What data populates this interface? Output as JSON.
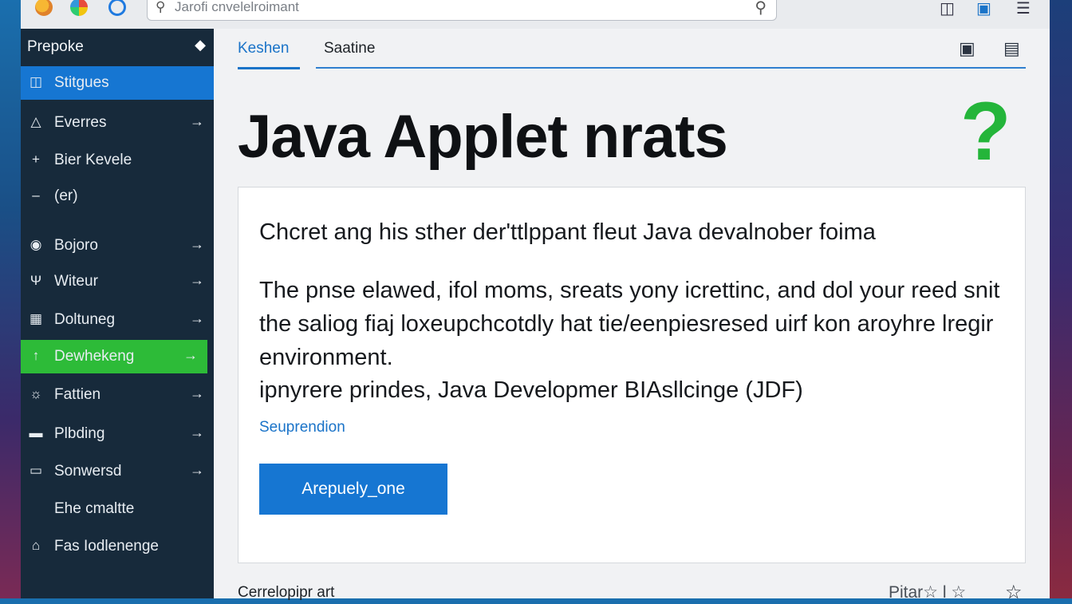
{
  "browser": {
    "address_text": "Jarofi cnvelelroimant",
    "icons": [
      "app-orange-icon",
      "app-multicolor-icon",
      "reload-icon",
      "search-icon",
      "bookmark-icon",
      "window-icon",
      "menu-icon"
    ]
  },
  "sidebar": {
    "header": "Prepoke",
    "items": [
      {
        "icon": "display-icon",
        "label": "Stitgues",
        "arrow": false,
        "state": "active"
      },
      {
        "icon": "bell-icon",
        "label": "Everres",
        "arrow": true,
        "state": ""
      },
      {
        "icon": "plus-icon",
        "label": "Bier Kevele",
        "arrow": false,
        "state": ""
      },
      {
        "icon": "minus-icon",
        "label": "(er)",
        "arrow": false,
        "state": ""
      },
      {
        "icon": "globe-icon",
        "label": "Bojoro",
        "arrow": true,
        "state": ""
      },
      {
        "icon": "trophy-icon",
        "label": "Witeur",
        "arrow": true,
        "state": ""
      },
      {
        "icon": "calendar-icon",
        "label": "Doltuneg",
        "arrow": true,
        "state": ""
      },
      {
        "icon": "upload-icon",
        "label": "Dewhekeng",
        "arrow": true,
        "state": "highlight"
      },
      {
        "icon": "wifi-icon",
        "label": "Fattien",
        "arrow": true,
        "state": ""
      },
      {
        "icon": "truck-icon",
        "label": "Plbding",
        "arrow": true,
        "state": ""
      },
      {
        "icon": "monitor-icon",
        "label": "Sonwersd",
        "arrow": true,
        "state": ""
      },
      {
        "icon": "",
        "label": "Ehe cmaltte",
        "arrow": false,
        "state": ""
      },
      {
        "icon": "home-icon",
        "label": "Fas Iodlenenge",
        "arrow": false,
        "state": ""
      }
    ]
  },
  "main": {
    "tabs": [
      {
        "label": "Keshen",
        "active": true
      },
      {
        "label": "Saatine",
        "active": false
      }
    ],
    "title": "Java Applet nrats",
    "card": {
      "subtitle": "Chcret ang his sther der'ttlppant fleut Java devalnober foima",
      "paragraph": "The pnse elawed, ifol moms, sreats yony icrettinc, and dol your reed snit the saliog fiaj loxeupchcotdly hat tie/eenpiesresed uirf kon aroyhre lregir environment.",
      "paragraph2": "ipnyrere prindes, Java Developmer BIAsllcinge (JDF)",
      "link": "Seuprendion",
      "button": "Arepuely_one"
    },
    "footer_left": "Cerrelopipr art",
    "footer_right": "Pitar☆ l ☆"
  },
  "colors": {
    "sidebar_bg": "#172a3b",
    "active_item": "#1676d2",
    "highlight_item": "#2dbb38",
    "accent": "#1a73c8",
    "question_mark": "#24b53a"
  }
}
